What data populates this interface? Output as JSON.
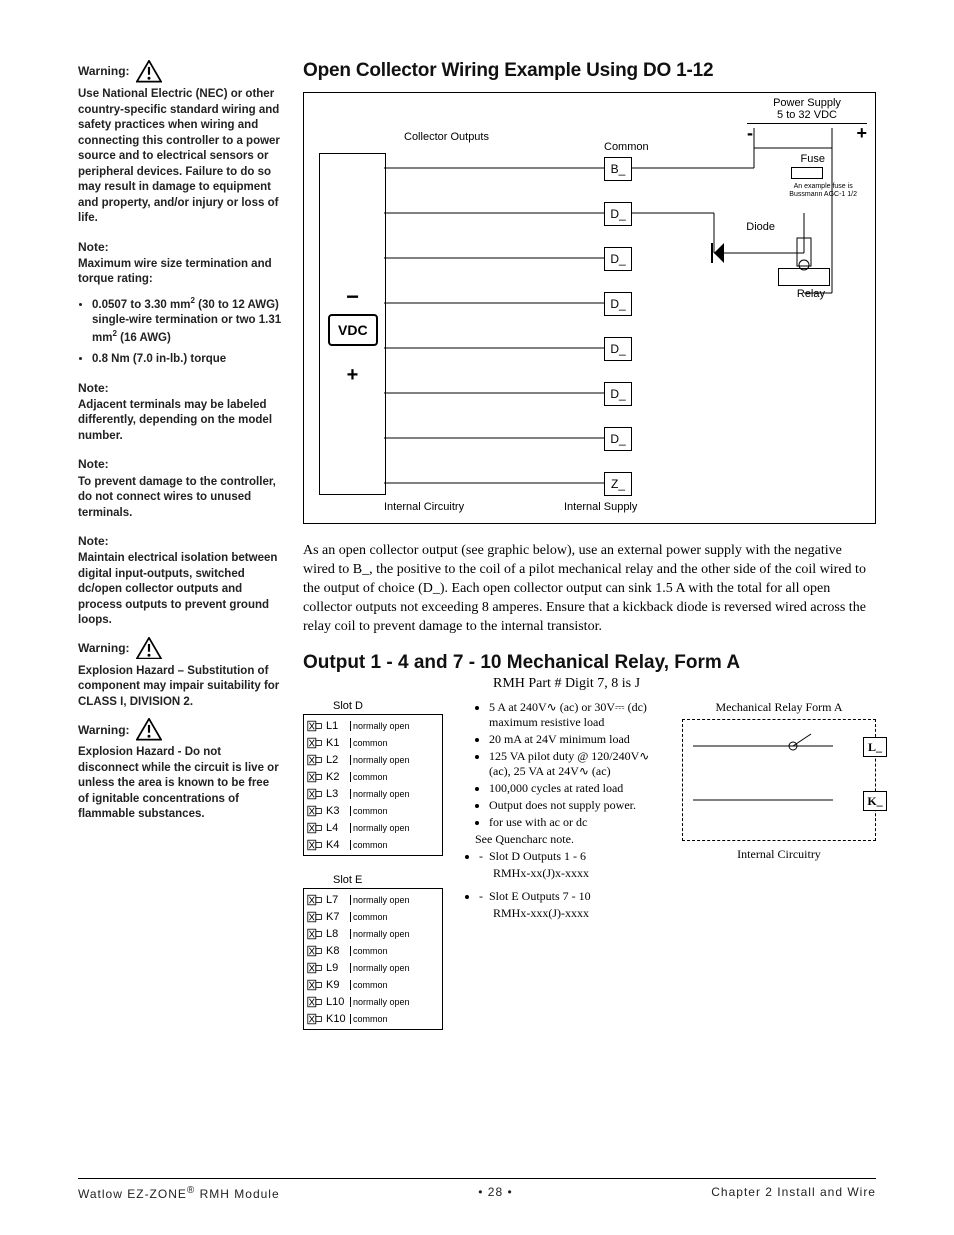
{
  "sidebar": {
    "warning1_label": "Warning:",
    "warning1_body": "Use National Electric (NEC) or other country-specific standard wiring and safety practices when wiring and connecting this controller to a power source and to electrical sensors or peripheral devices. Failure to do so may result in damage to equipment and property, and/or injury or loss of life.",
    "note1_label": "Note:",
    "note1_body": "Maximum wire size termination and torque rating:",
    "note1_li1_a": "0.0507 to 3.30 mm",
    "note1_li1_b": " (30 to 12 AWG) single-wire termination or two 1.31 mm",
    "note1_li1_c": " (16 AWG)",
    "note1_li2": "0.8 Nm (7.0 in-lb.) torque",
    "note2_label": "Note:",
    "note2_body": "Adjacent terminals may be labeled differently, depending on the model number.",
    "note3_label": "Note:",
    "note3_body": "To prevent damage to the controller, do not connect wires to unused terminals.",
    "note4_label": "Note:",
    "note4_body": "Maintain electrical isolation between digital input-outputs, switched dc/open collector outputs and process outputs to prevent ground loops.",
    "warning2_label": "Warning:",
    "warning2_body": "Explosion Hazard – Substitution of component may impair suitability for CLASS I, DIVISION 2.",
    "warning3_label": "Warning:",
    "warning3_body": "Explosion Hazard - Do not disconnect while the circuit is live or unless the area is known to be free of ignitable concentrations of flammable substances."
  },
  "main": {
    "h1": "Open Collector Wiring Example Using DO 1-12",
    "diagram": {
      "collector_outputs": "Collector Outputs",
      "common": "Common",
      "power_supply_l1": "Power Supply",
      "power_supply_l2": "5 to 32 VDC",
      "minus": "-",
      "plus": "+",
      "fuse": "Fuse",
      "fuse_note_l1": "An example fuse is",
      "fuse_note_l2": "Bussmann AGC-1 1/2",
      "diode": "Diode",
      "relay": "Relay",
      "vdc": "VDC",
      "big_minus": "−",
      "big_plus": "+",
      "internal_circuitry": "Internal Circuitry",
      "internal_supply": "Internal Supply",
      "term_B": "B_",
      "term_D": "D_",
      "term_Z": "Z_"
    },
    "para1": "As an open collector output (see graphic below), use an external power supply with the negative wired to B_, the positive to the coil of a pilot mechanical relay and the other side of the coil wired to the output of choice (D_). Each open collector output can sink 1.5 A with the total for all open collector outputs not exceeding 8 amperes. Ensure that a kickback diode is reversed wired across the relay coil to prevent damage to the internal transistor.",
    "h2": "Output 1 - 4 and 7 - 10 Mechanical Relay, Form A",
    "rmh_sub": "RMH Part # Digit 7, 8 is J",
    "slots": {
      "d_title": "Slot D",
      "e_title": "Slot E",
      "d_rows": [
        {
          "id": "L1",
          "lbl": "normally open"
        },
        {
          "id": "K1",
          "lbl": "common"
        },
        {
          "id": "L2",
          "lbl": "normally open"
        },
        {
          "id": "K2",
          "lbl": "common"
        },
        {
          "id": "L3",
          "lbl": "normally open"
        },
        {
          "id": "K3",
          "lbl": "common"
        },
        {
          "id": "L4",
          "lbl": "normally open"
        },
        {
          "id": "K4",
          "lbl": "common"
        }
      ],
      "e_rows": [
        {
          "id": "L7",
          "lbl": "normally open"
        },
        {
          "id": "K7",
          "lbl": "common"
        },
        {
          "id": "L8",
          "lbl": "normally open"
        },
        {
          "id": "K8",
          "lbl": "common"
        },
        {
          "id": "L9",
          "lbl": "normally open"
        },
        {
          "id": "K9",
          "lbl": "common"
        },
        {
          "id": "L10",
          "lbl": "normally open"
        },
        {
          "id": "K10",
          "lbl": "common"
        }
      ]
    },
    "bullets": {
      "b1": "5 A at 240V∿ (ac) or 30V⎓ (dc) maximum resistive load",
      "b2": "20 mA at 24V minimum load",
      "b3": "125 VA pilot duty @ 120/240V∿ (ac), 25 VA at 24V∿ (ac)",
      "b4": "100,000 cycles at rated load",
      "b5": "Output does not supply power.",
      "b6": "for use with ac or dc",
      "see": "See Quencharc note.",
      "d1": "Slot D Outputs 1 - 6",
      "d1s": "RMHx-xx(J)x-xxxx",
      "d2": "Slot E Outputs 7 - 10",
      "d2s": "RMHx-xxx(J)-xxxx"
    },
    "relay_diag": {
      "title": "Mechanical Relay Form A",
      "L": "L_",
      "K": "K_",
      "ic": "Internal Circuitry"
    }
  },
  "footer": {
    "left_a": "Watlow EZ-ZONE",
    "left_b": " RMH Module",
    "center": "•  28  •",
    "right": "Chapter 2 Install and Wire"
  }
}
